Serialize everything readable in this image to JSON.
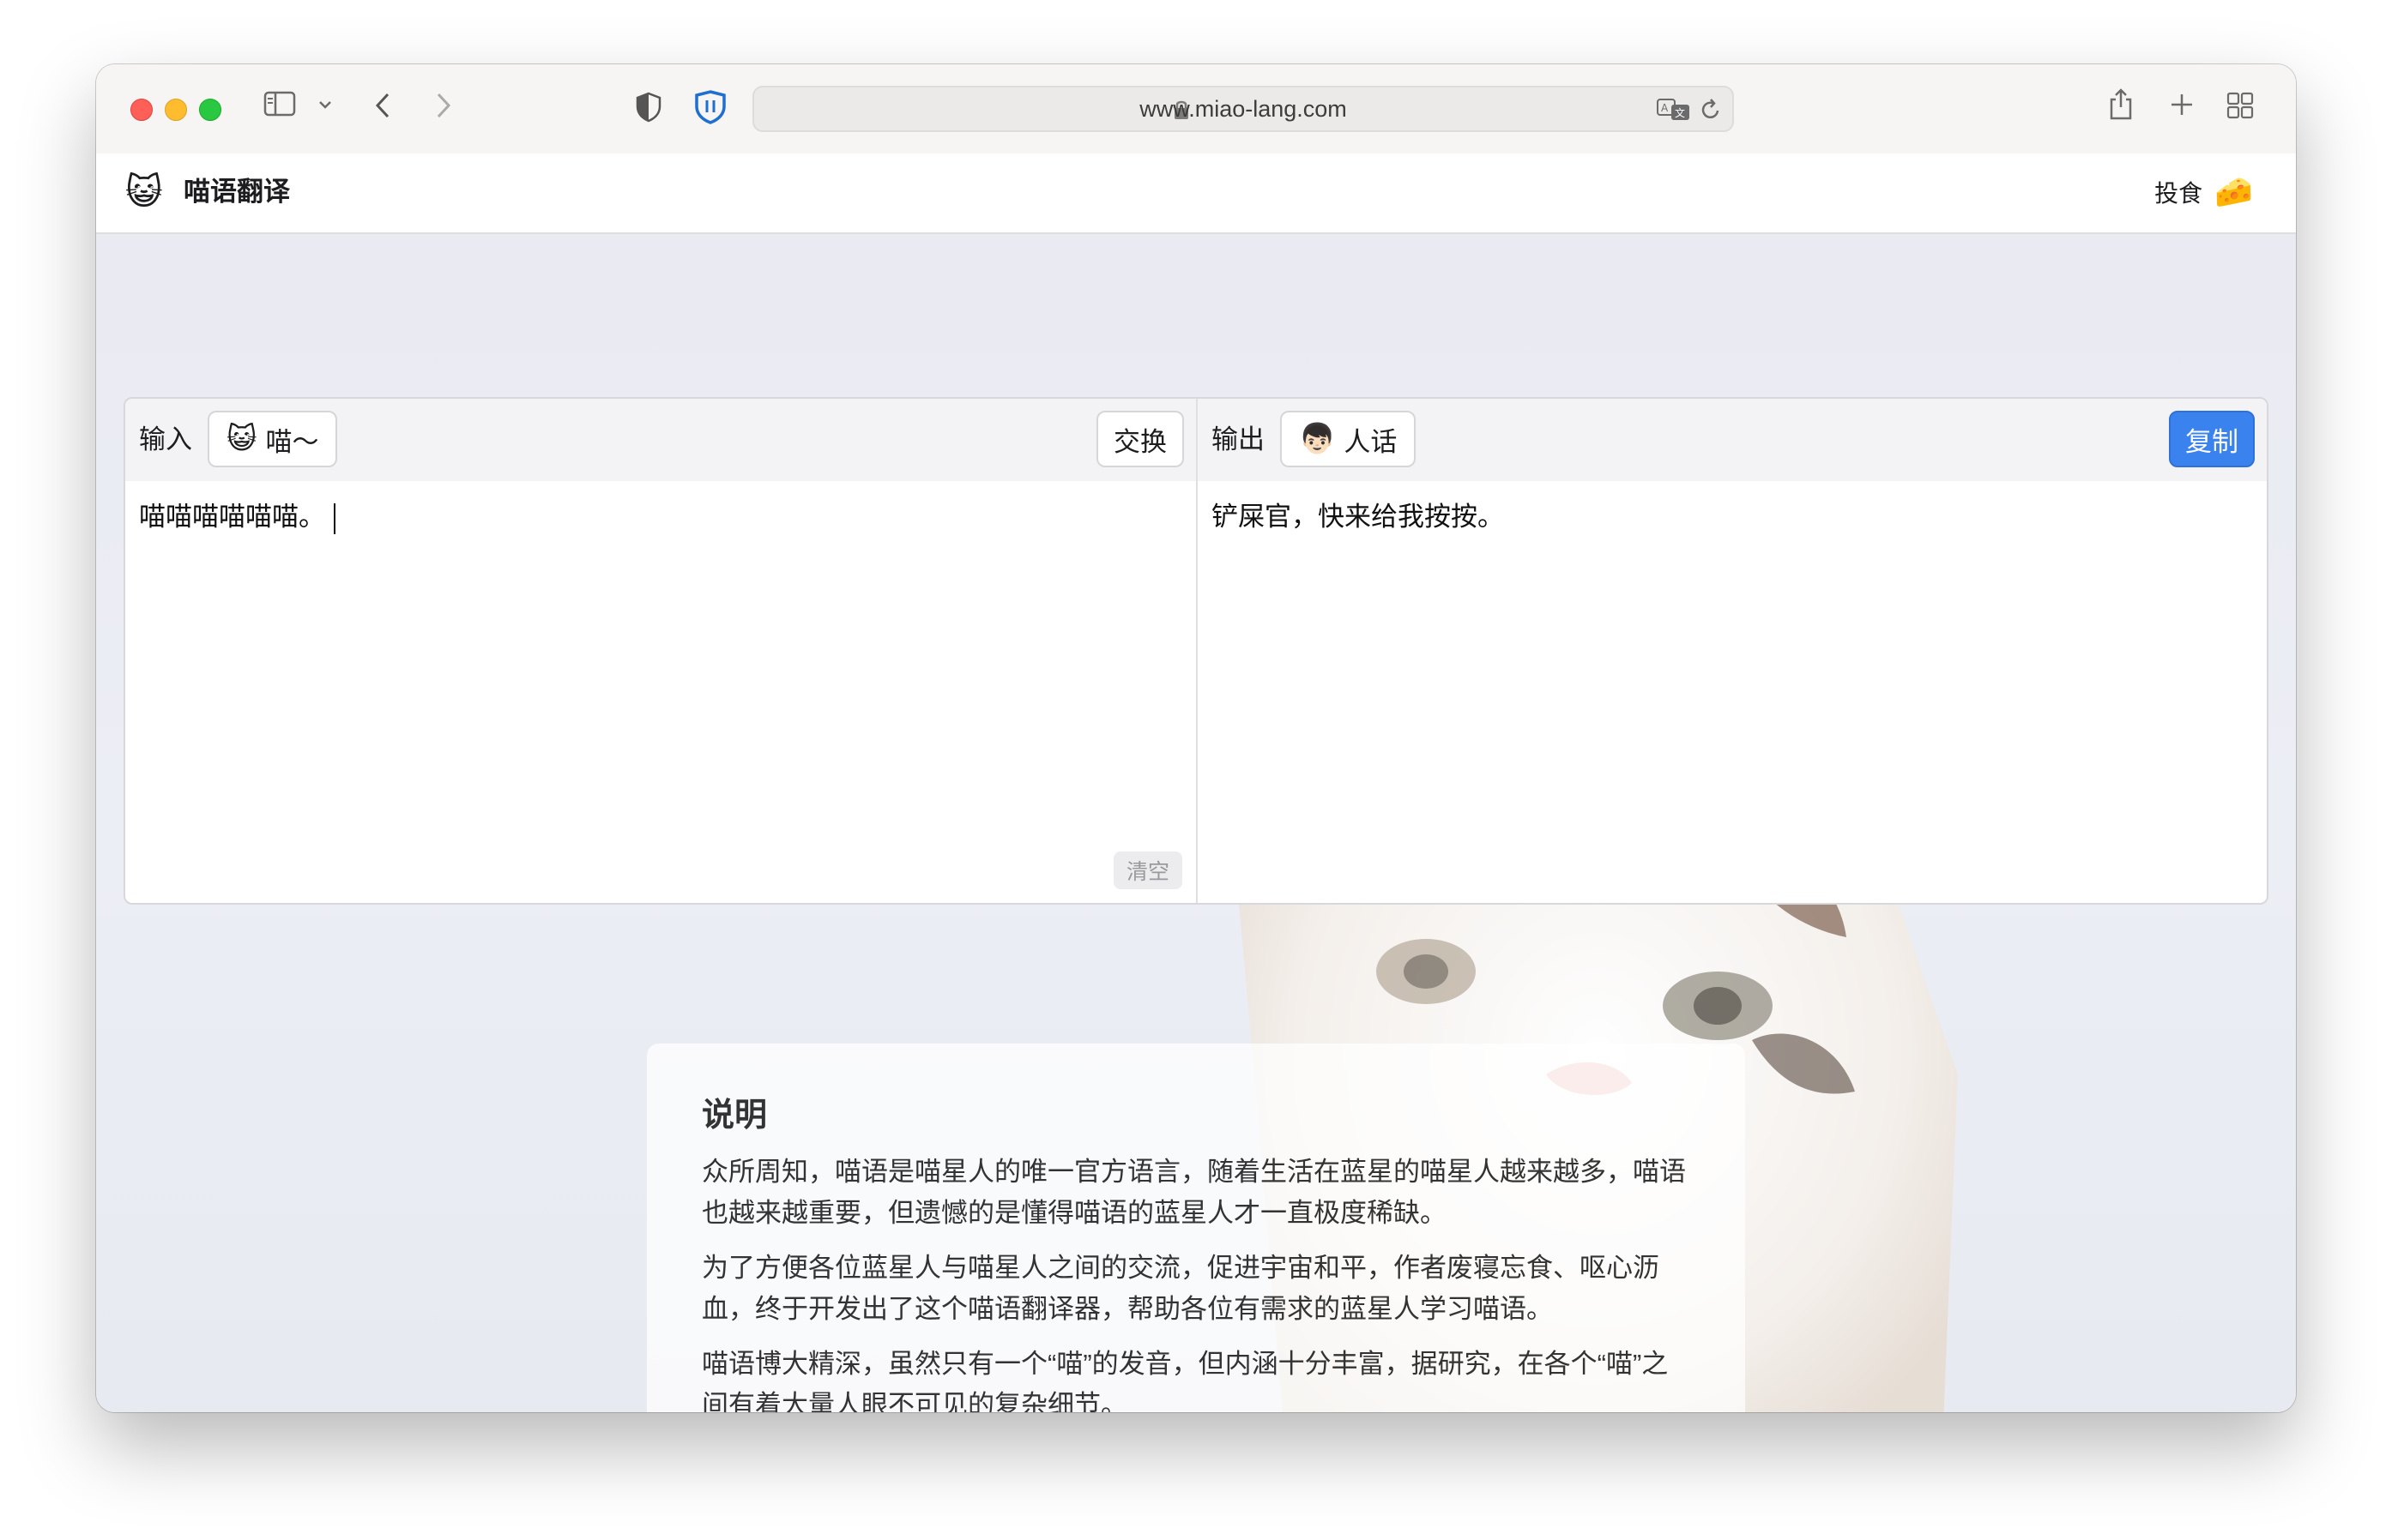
{
  "browser": {
    "url": "www.miao-lang.com"
  },
  "header": {
    "logo_emoji": "😺",
    "title": "喵语翻译",
    "feed_label": "投食",
    "feed_emoji": "🧀"
  },
  "translator": {
    "input": {
      "label": "输入",
      "lang_emoji": "😺",
      "lang_label": "喵～",
      "swap_label": "交换",
      "text": "喵喵喵喵喵喵。",
      "clear_label": "清空"
    },
    "output": {
      "label": "输出",
      "lang_emoji": "👦🏻",
      "lang_label": "人话",
      "copy_label": "复制",
      "text": "铲屎官，快来给我按按。"
    }
  },
  "description": {
    "title": "说明",
    "paragraphs": [
      "众所周知，喵语是喵星人的唯一官方语言，随着生活在蓝星的喵星人越来越多，喵语也越来越重要，但遗憾的是懂得喵语的蓝星人才一直极度稀缺。",
      "为了方便各位蓝星人与喵星人之间的交流，促进宇宙和平，作者废寝忘食、呕心沥血，终于开发出了这个喵语翻译器，帮助各位有需求的蓝星人学习喵语。",
      "喵语博大精深，虽然只有一个“喵”的发音，但内涵十分丰富，据研究，在各个“喵”之间有着大量人眼不可见的复杂细节。"
    ]
  },
  "colors": {
    "accent": "#3a82ee",
    "traffic_red": "#fe5f57",
    "traffic_yellow": "#febc2e",
    "traffic_green": "#28c840"
  },
  "icons": [
    "sidebar-icon",
    "chevron-down-icon",
    "back-icon",
    "forward-icon",
    "shield-icon",
    "bitwarden-icon",
    "lock-icon",
    "translate-icon",
    "reload-icon",
    "share-icon",
    "new-tab-icon",
    "tab-overview-icon"
  ]
}
